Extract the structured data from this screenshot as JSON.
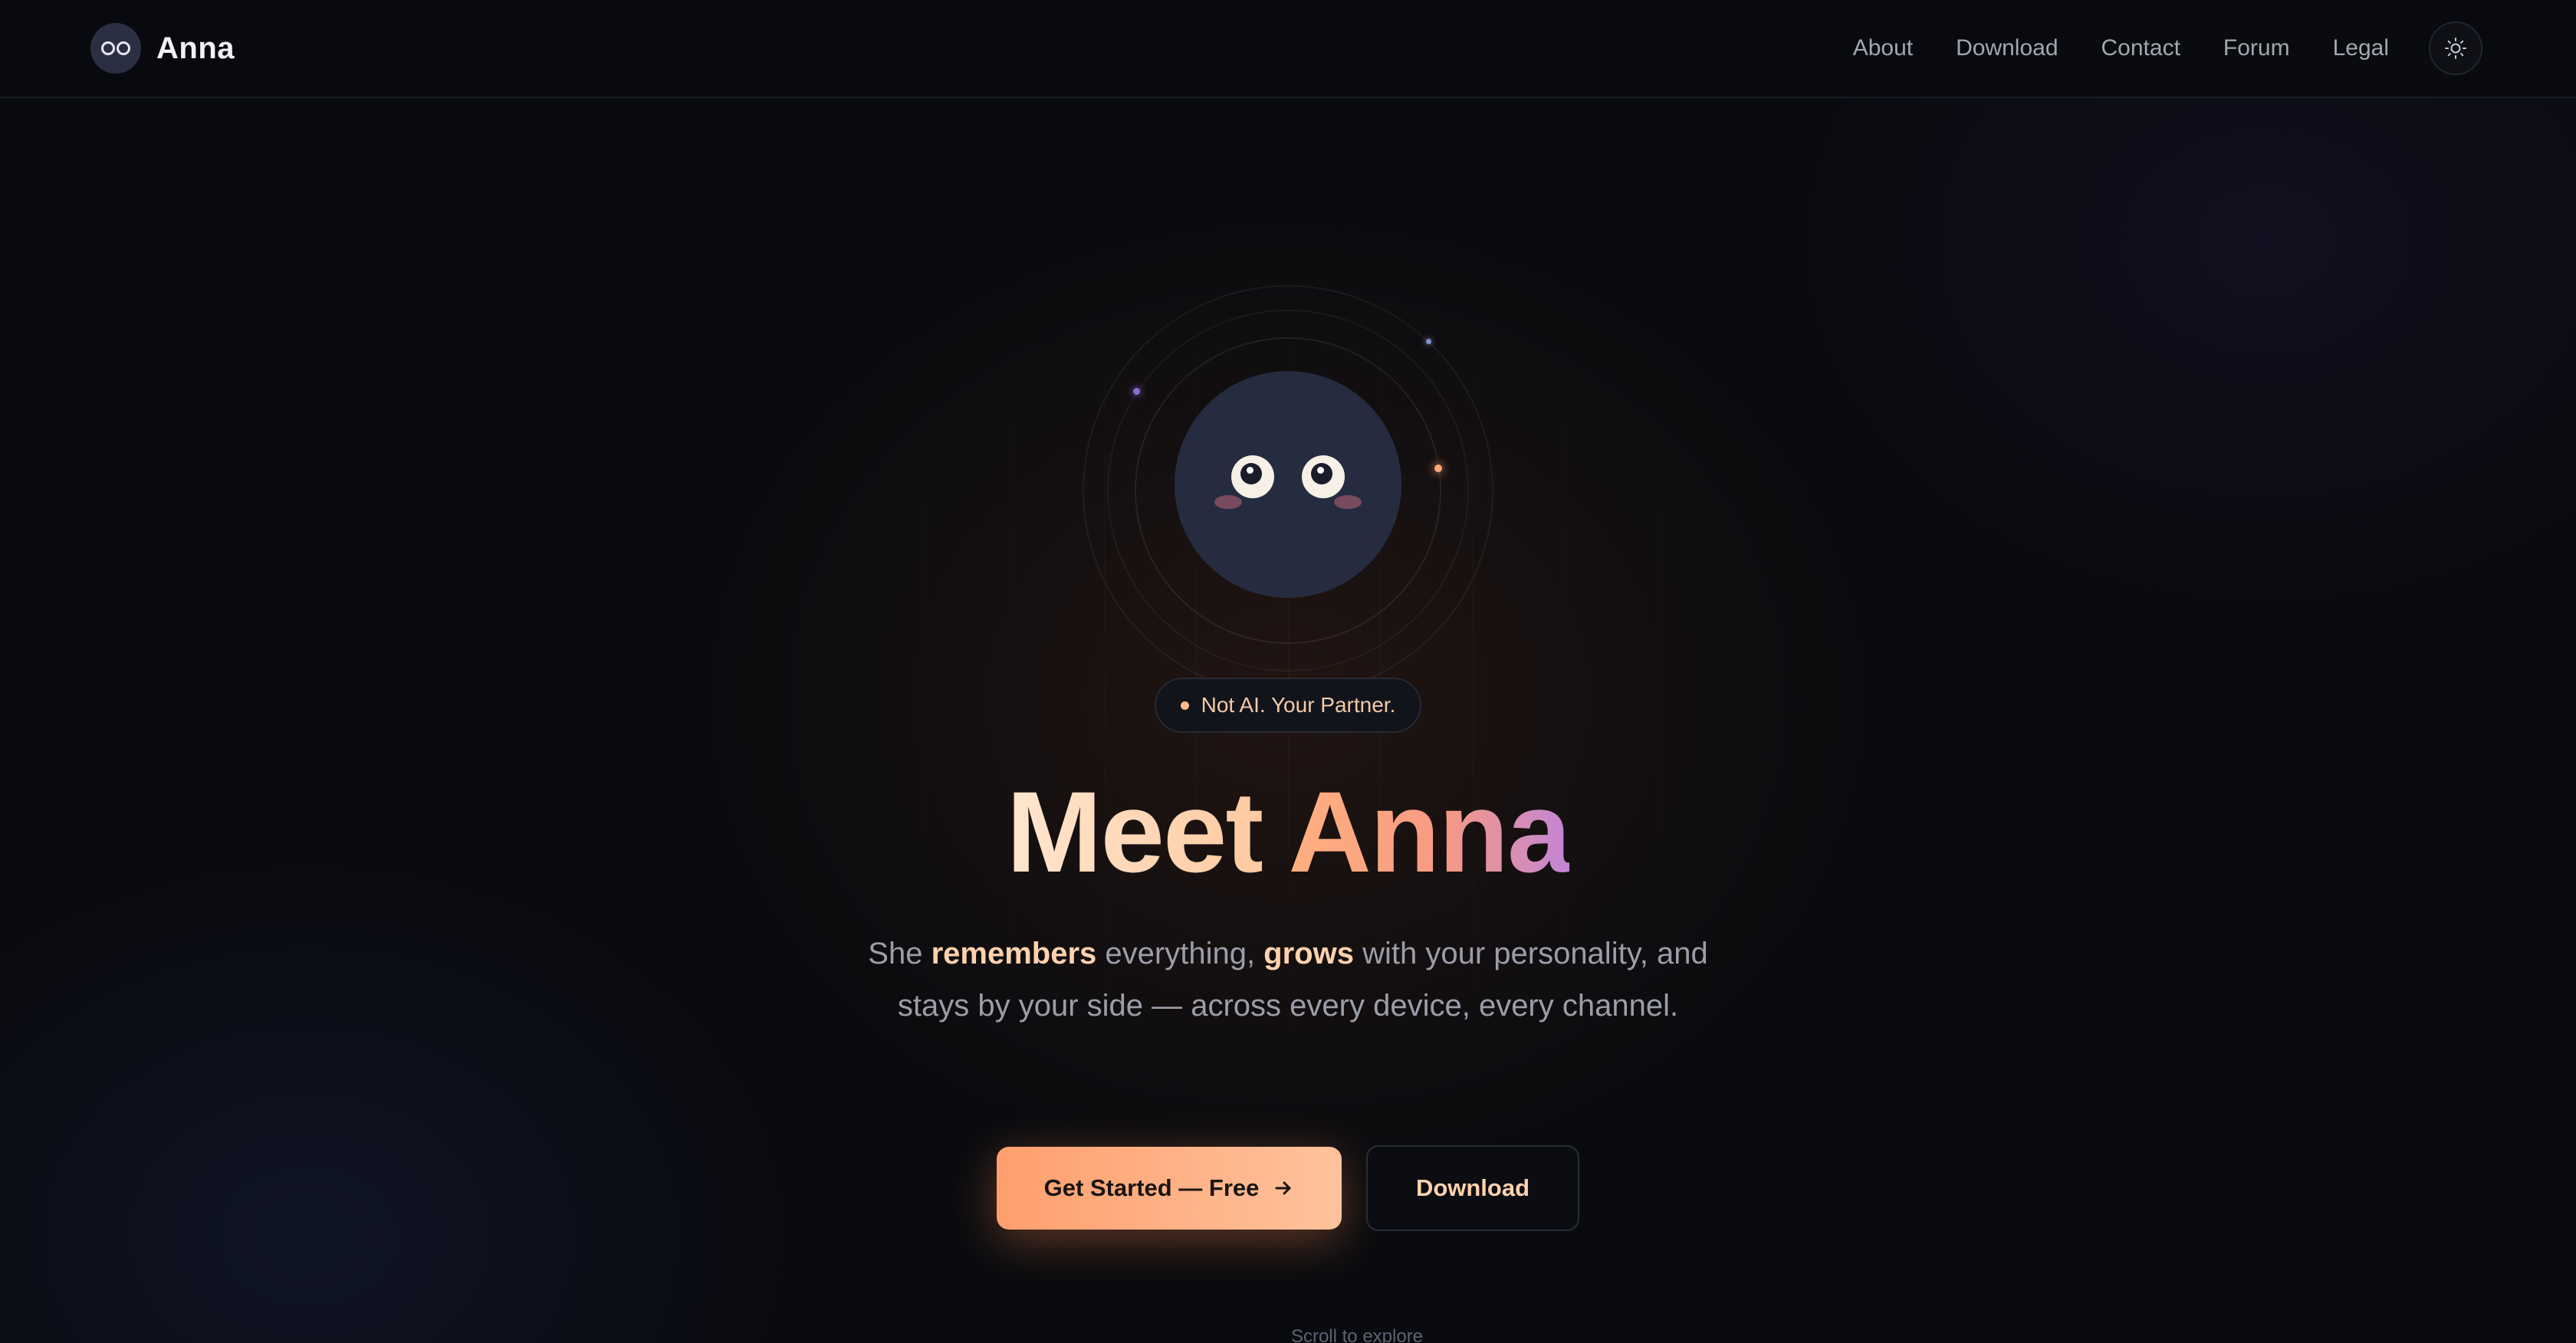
{
  "brand": {
    "name": "Anna",
    "logo_icon": "mascot-face-icon"
  },
  "nav": {
    "items": [
      {
        "label": "About"
      },
      {
        "label": "Download"
      },
      {
        "label": "Contact"
      },
      {
        "label": "Forum"
      },
      {
        "label": "Legal"
      }
    ],
    "theme_toggle_icon": "sun-icon"
  },
  "hero": {
    "badge": "Not AI. Your Partner.",
    "title_part1": "Meet",
    "title_part2": "Anna",
    "subtitle": {
      "s1": "She ",
      "h1": "remembers",
      "s2": " everything, ",
      "h2": "grows",
      "s3": " with your personality, and stays by your side — across every device, every channel."
    },
    "primary_button": "Get Started — Free",
    "primary_button_icon": "arrow-right-icon",
    "secondary_button": "Download",
    "scroll_hint": "Scroll to explore"
  },
  "colors": {
    "background": "#0a0b0f",
    "accent": "#ff9f6e",
    "accent_light": "#ffc29c",
    "highlight_text": "#ffd2ad",
    "mascot_body": "#252c3f"
  }
}
